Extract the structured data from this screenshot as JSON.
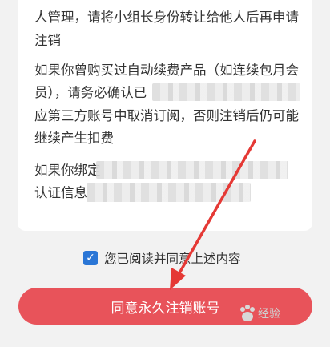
{
  "notice": {
    "line1": "人管理，请将小组长身份转让给他人后再申请",
    "line2": "注销",
    "line3": "如果你曾购买过自动续费产品（如连续包月会",
    "line4": "员），请务必确认已",
    "line5": "应第三方账号中取消订阅，否则注销后仍可能",
    "line6": "继续产生扣费",
    "line7": "如果你绑定",
    "line8": "认证信息"
  },
  "agreement": {
    "checked": true,
    "label": "您已阅读并同意上述内容"
  },
  "confirm_button": {
    "label": "同意永久注销账号"
  },
  "watermark": {
    "text": "经验"
  },
  "colors": {
    "button": "#e8535a",
    "checkbox": "#2a76d6",
    "arrow": "#e53935"
  }
}
